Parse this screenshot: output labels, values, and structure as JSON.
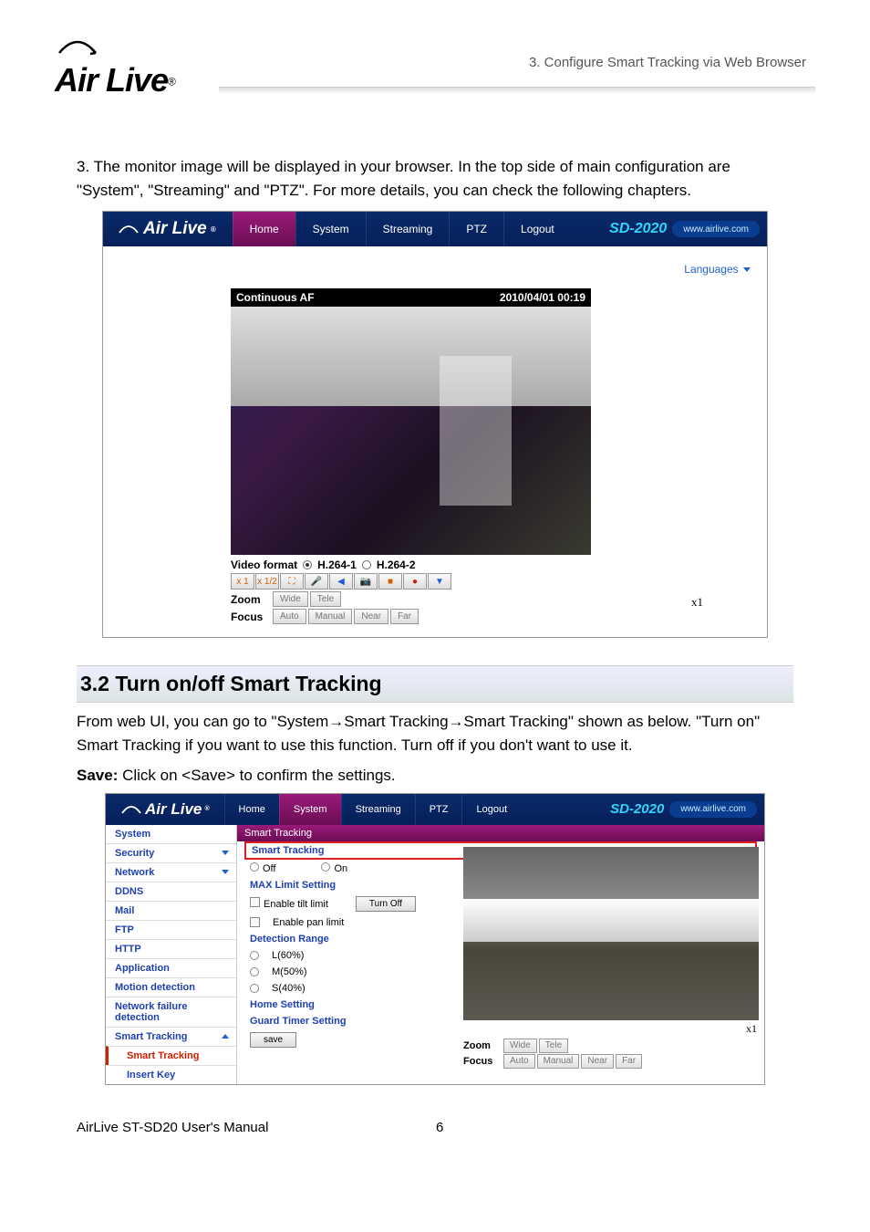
{
  "header": {
    "logo_text": "Air Live",
    "breadcrumb": "3. Configure Smart Tracking via Web Browser"
  },
  "body_text_1": "3. The monitor image will be displayed in your browser. In the top side of main configuration are \"System\", \"Streaming\" and \"PTZ\". For more details, you can check the following chapters.",
  "screenshot1": {
    "logo": "Air Live",
    "tabs": [
      "Home",
      "System",
      "Streaming",
      "PTZ",
      "Logout"
    ],
    "model": "SD-2020",
    "url": "www.airlive.com",
    "languages": "Languages",
    "view_title": "Continuous AF",
    "timestamp": "2010/04/01 00:19",
    "video_format_label": "Video format",
    "vf_opt1": "H.264-1",
    "vf_opt2": "H.264-2",
    "btns": {
      "x1": "x 1",
      "x12": "x 1/2"
    },
    "zoom_label": "Zoom",
    "zoom_wide": "Wide",
    "zoom_tele": "Tele",
    "x1": "x1",
    "focus_label": "Focus",
    "focus_auto": "Auto",
    "focus_manual": "Manual",
    "focus_near": "Near",
    "focus_far": "Far"
  },
  "section_3_2_heading": "3.2 Turn on/off Smart Tracking",
  "para_3_2_1": "From web UI, you can go to \"System→Smart Tracking→Smart Tracking\" shown as below. \"Turn on\" Smart Tracking if you want to use this function. Turn off if you don't want to use it.",
  "para_3_2_save_label": "Save:",
  "para_3_2_save_rest": " Click on <Save> to confirm the settings.",
  "screenshot2": {
    "logo": "Air Live",
    "tabs": [
      "Home",
      "System",
      "Streaming",
      "PTZ",
      "Logout"
    ],
    "model": "SD-2020",
    "url": "www.airlive.com",
    "sidebar": [
      "System",
      "Security",
      "Network",
      "DDNS",
      "Mail",
      "FTP",
      "HTTP",
      "Application",
      "Motion detection",
      "Network failure detection",
      "Smart Tracking"
    ],
    "sidebar_sub": [
      "Smart Tracking",
      "Insert Key"
    ],
    "bar": "Smart Tracking",
    "box_hdr": "Smart Tracking",
    "off": "Off",
    "on": "On",
    "max_limit": "MAX Limit Setting",
    "enable_tilt": "Enable tilt limit",
    "turn_off": "Turn Off",
    "enable_pan": "Enable pan limit",
    "detection": "Detection Range",
    "l60": "L(60%)",
    "m50": "M(50%)",
    "s40": "S(40%)",
    "home_setting": "Home Setting",
    "guard_timer": "Guard Timer Setting",
    "save": "save",
    "zoom_label": "Zoom",
    "zoom_wide": "Wide",
    "zoom_tele": "Tele",
    "focus_label": "Focus",
    "focus_auto": "Auto",
    "focus_manual": "Manual",
    "focus_near": "Near",
    "focus_far": "Far",
    "x1": "x1"
  },
  "footer": {
    "left": "AirLive ST-SD20 User's Manual",
    "page": "6"
  }
}
